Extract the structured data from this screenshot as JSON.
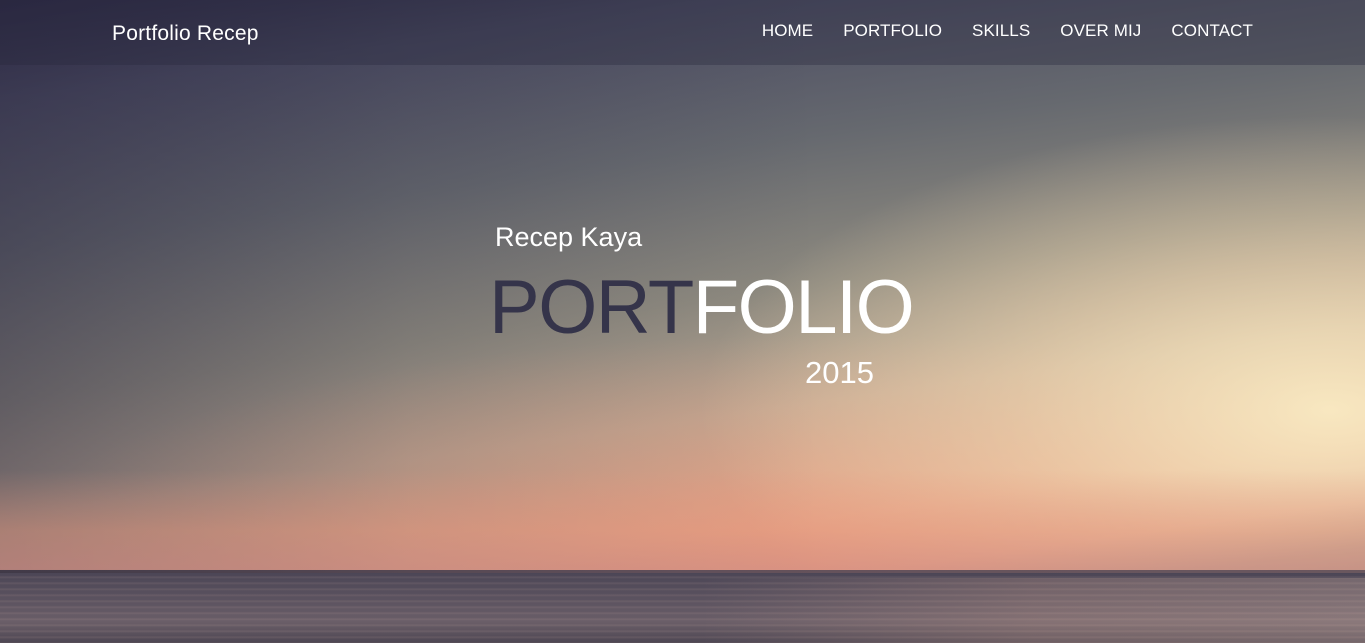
{
  "brand": {
    "title": "Portfolio Recep"
  },
  "nav": {
    "items": [
      {
        "label": "HOME"
      },
      {
        "label": "PORTFOLIO"
      },
      {
        "label": "SKILLS"
      },
      {
        "label": "OVER MIJ"
      },
      {
        "label": "CONTACT"
      }
    ]
  },
  "hero": {
    "name": "Recep Kaya",
    "title_part1": "PORT",
    "title_part2": "FOLIO",
    "year": "2015"
  },
  "colors": {
    "title_part1": "#35344a",
    "title_part2": "#ffffff",
    "nav_text": "#ffffff"
  }
}
